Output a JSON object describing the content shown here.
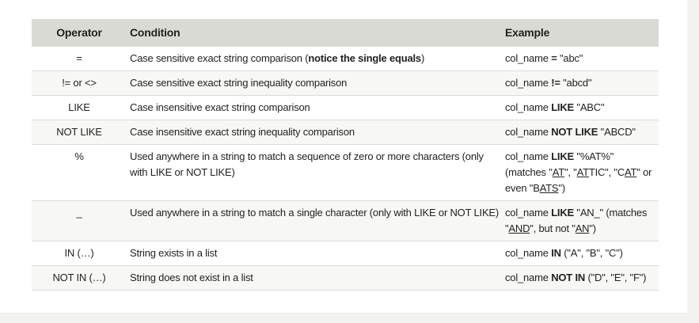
{
  "headers": {
    "operator": "Operator",
    "condition": "Condition",
    "example": "Example"
  },
  "rows": [
    {
      "operator": "=",
      "condition_prefix": "Case sensitive exact string comparison (",
      "condition_bold": "notice the single equals",
      "condition_suffix": ")",
      "example_pre": "col_name ",
      "example_kw": "=",
      "example_post": " \"abc\""
    },
    {
      "operator": "!= or <>",
      "condition": "Case sensitive exact string inequality comparison",
      "example_pre": "col_name ",
      "example_kw": "!=",
      "example_post": " \"abcd\""
    },
    {
      "operator": "LIKE",
      "condition": "Case insensitive exact string comparison",
      "example_pre": "col_name ",
      "example_kw": "LIKE",
      "example_post": " \"ABC\""
    },
    {
      "operator": "NOT LIKE",
      "condition": "Case insensitive exact string inequality comparison",
      "example_pre": "col_name ",
      "example_kw": "NOT LIKE",
      "example_post": " \"ABCD\""
    },
    {
      "operator": "%",
      "condition": "Used anywhere in a string to match a sequence of zero or more characters (only with LIKE or NOT LIKE)",
      "example_pre": "col_name ",
      "example_kw": "LIKE",
      "example_post": " \"%AT%\"",
      "match_parts": [
        {
          "t": "(matches \""
        },
        {
          "t": "AT",
          "u": true
        },
        {
          "t": "\", \""
        },
        {
          "t": "AT",
          "u": true
        },
        {
          "t": "TIC\", \"C"
        },
        {
          "t": "AT",
          "u": true
        },
        {
          "t": "\" or even \"B"
        },
        {
          "t": "ATS",
          "u": true
        },
        {
          "t": "\")"
        }
      ]
    },
    {
      "operator": "_",
      "condition": "Used anywhere in a string to match a single character (only with LIKE or NOT LIKE)",
      "example_pre": "col_name ",
      "example_kw": "LIKE",
      "example_post": " \"AN_\"",
      "match_parts": [
        {
          "t": "(matches \""
        },
        {
          "t": "AND",
          "u": true
        },
        {
          "t": "\", but not \""
        },
        {
          "t": "AN",
          "u": true
        },
        {
          "t": "\")"
        }
      ]
    },
    {
      "operator": "IN (…)",
      "condition": "String exists in a list",
      "example_pre": "col_name ",
      "example_kw": "IN",
      "example_post": " (\"A\", \"B\", \"C\")"
    },
    {
      "operator": "NOT IN (…)",
      "condition": "String does not exist in a list",
      "example_pre": "col_name ",
      "example_kw": "NOT IN",
      "example_post": " (\"D\", \"E\", \"F\")"
    }
  ]
}
